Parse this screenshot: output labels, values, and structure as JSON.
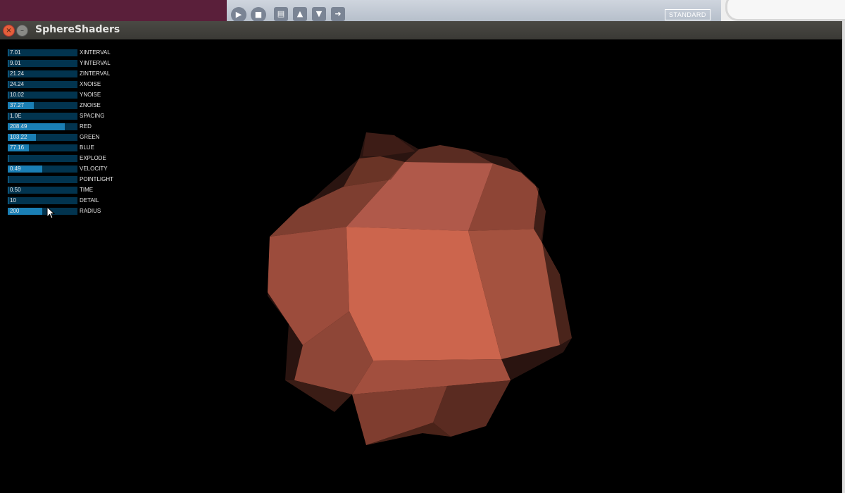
{
  "window": {
    "title": "SphereShaders"
  },
  "ide_toolbar": {
    "mode_label": "STANDARD",
    "buttons": [
      "run-icon",
      "stop-icon",
      "new-icon",
      "open-icon",
      "save-icon",
      "export-icon"
    ]
  },
  "sliders": [
    {
      "label": "XINTERVAL",
      "value": "7.01",
      "fill": 0.01
    },
    {
      "label": "YINTERVAL",
      "value": "9.01",
      "fill": 0.01
    },
    {
      "label": "ZINTERVAL",
      "value": "21.24",
      "fill": 0.01
    },
    {
      "label": "XNOISE",
      "value": "24.24",
      "fill": 0.01
    },
    {
      "label": "YNOISE",
      "value": "10.02",
      "fill": 0.01
    },
    {
      "label": "ZNOISE",
      "value": "37.27",
      "fill": 0.37
    },
    {
      "label": "SPACING",
      "value": "1.0E",
      "fill": 0.01
    },
    {
      "label": "RED",
      "value": "208.49",
      "fill": 0.82
    },
    {
      "label": "GREEN",
      "value": "103.22",
      "fill": 0.4
    },
    {
      "label": "BLUE",
      "value": "77.16",
      "fill": 0.3
    },
    {
      "label": "EXPLODE",
      "value": "",
      "fill": 0.01
    },
    {
      "label": "VELOCITY",
      "value": "0.49",
      "fill": 0.49
    },
    {
      "label": "POINTLIGHT",
      "value": "",
      "fill": 0.01
    },
    {
      "label": "TIME",
      "value": "0.50",
      "fill": 0.01
    },
    {
      "label": "DETAIL",
      "value": "10",
      "fill": 0.01
    },
    {
      "label": "RADIUS",
      "value": "200",
      "fill": 0.49
    }
  ],
  "colors": {
    "slider_track": "#02344f",
    "slider_fill": "#1a7fb5",
    "shape_base": "#cc654d",
    "background": "#000000"
  }
}
